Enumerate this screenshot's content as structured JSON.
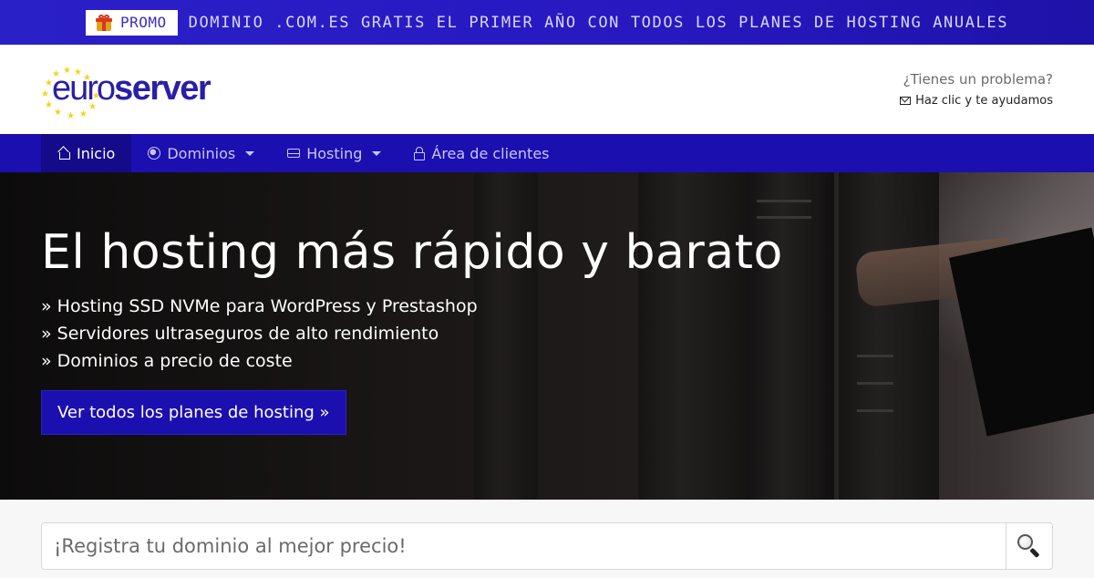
{
  "promo": {
    "badge_label": "PROMO",
    "badge_icon": "gift-icon",
    "text": "DOMINIO .COM.ES GRATIS EL PRIMER AÑO CON TODOS LOS PLANES DE HOSTING ANUALES"
  },
  "header": {
    "logo_text_light": "euro",
    "logo_text_bold": "server",
    "help_title": "¿Tienes un problema?",
    "help_link": "Haz clic y te ayudamos",
    "help_icon": "envelope-icon"
  },
  "nav": {
    "items": [
      {
        "label": "Inicio",
        "icon": "home-icon",
        "active": true,
        "dropdown": false
      },
      {
        "label": "Dominios",
        "icon": "globe-icon",
        "active": false,
        "dropdown": true
      },
      {
        "label": "Hosting",
        "icon": "hdd-icon",
        "active": false,
        "dropdown": true
      },
      {
        "label": "Área de clientes",
        "icon": "lock-icon",
        "active": false,
        "dropdown": false
      }
    ]
  },
  "hero": {
    "title": "El hosting más rápido y barato",
    "features": [
      "» Hosting SSD NVMe para WordPress y Prestashop",
      "» Servidores ultraseguros de alto rendimiento",
      "» Dominios a precio de coste"
    ],
    "cta_label": "Ver todos los planes de hosting »"
  },
  "search": {
    "placeholder": "¡Registra tu dominio al mejor precio!",
    "value": "",
    "button_icon": "search-icon"
  },
  "colors": {
    "brand_blue": "#1c0fb0",
    "promo_blue": "#2a20c8",
    "nav_active": "#140a8a",
    "logo_star": "#f2d41f"
  }
}
